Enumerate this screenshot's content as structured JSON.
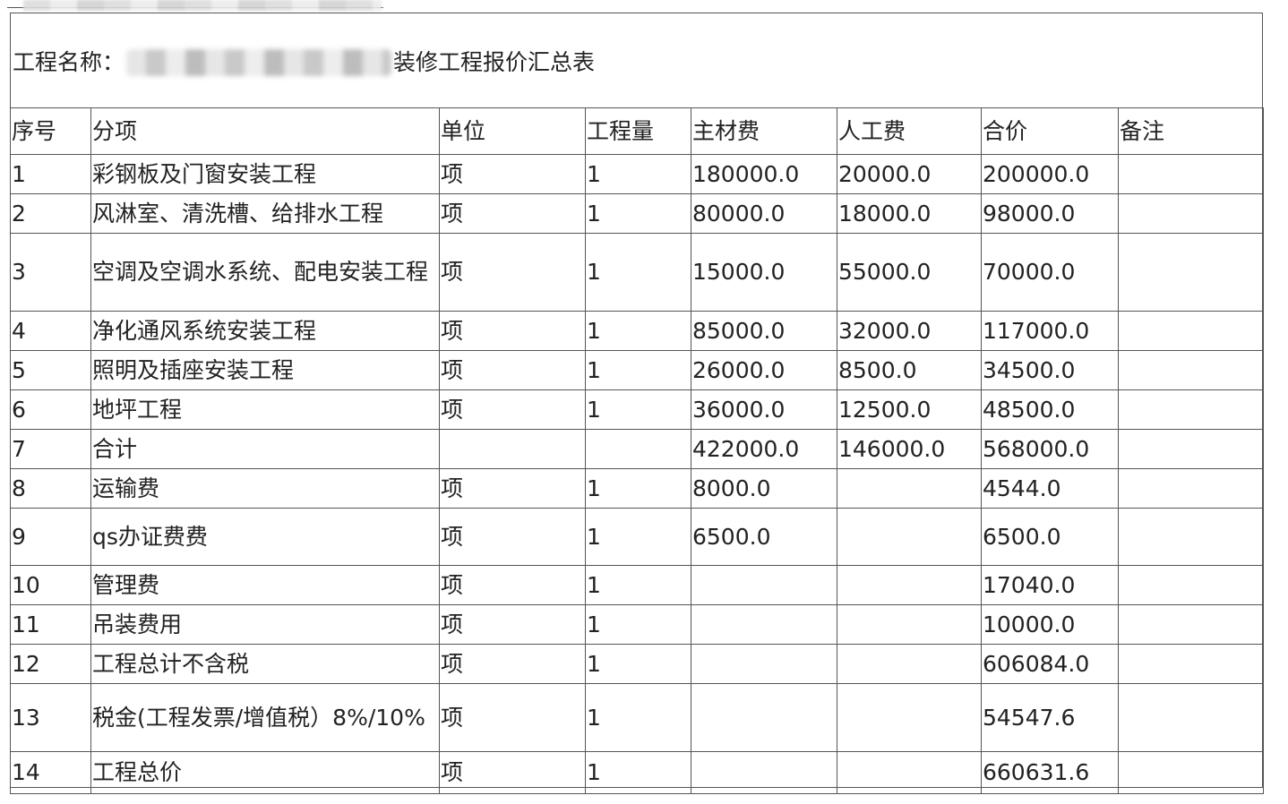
{
  "title": {
    "label": "工程名称：",
    "suffix": "装修工程报价汇总表"
  },
  "headers": [
    "序号",
    "分项",
    "单位",
    "工程量",
    "主材费",
    "人工费",
    "合价",
    "备注"
  ],
  "rows": [
    [
      "1",
      "彩钢板及门窗安装工程",
      "项",
      "1",
      "180000.0",
      "20000.0",
      "200000.0",
      ""
    ],
    [
      "2",
      "风淋室、清洗槽、给排水工程",
      "项",
      "1",
      "80000.0",
      "18000.0",
      "98000.0",
      ""
    ],
    [
      "3",
      "空调及空调水系统、配电安装工程",
      "项",
      "1",
      "15000.0",
      "55000.0",
      "70000.0",
      ""
    ],
    [
      "4",
      "净化通风系统安装工程",
      "项",
      "1",
      "85000.0",
      "32000.0",
      "117000.0",
      ""
    ],
    [
      "5",
      "照明及插座安装工程",
      "项",
      "1",
      "26000.0",
      "8500.0",
      "34500.0",
      ""
    ],
    [
      "6",
      "地坪工程",
      "项",
      "1",
      "36000.0",
      "12500.0",
      "48500.0",
      ""
    ],
    [
      "7",
      "合计",
      "",
      "",
      "422000.0",
      "146000.0",
      "568000.0",
      ""
    ],
    [
      "8",
      "运输费",
      "项",
      "1",
      "8000.0",
      "",
      "4544.0",
      ""
    ],
    [
      "9",
      "qs办证费费",
      "项",
      "1",
      "6500.0",
      "",
      "6500.0",
      ""
    ],
    [
      "10",
      "管理费",
      "项",
      "1",
      "",
      "",
      "17040.0",
      ""
    ],
    [
      "11",
      "吊装费用",
      "项",
      "1",
      "",
      "",
      "10000.0",
      ""
    ],
    [
      "12",
      "工程总计不含税",
      "项",
      "1",
      "",
      "",
      "606084.0",
      ""
    ],
    [
      "13",
      "税金(工程发票/增值税）8%/10%",
      "项",
      "1",
      "",
      "",
      "54547.6",
      ""
    ],
    [
      "14",
      "工程总价",
      "项",
      "1",
      "",
      "",
      "660631.6",
      ""
    ]
  ]
}
